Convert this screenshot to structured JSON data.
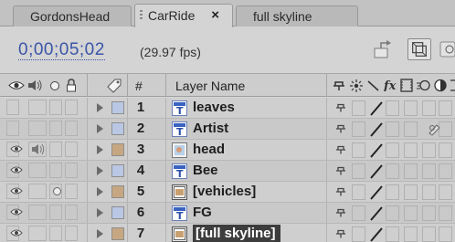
{
  "tabs": [
    {
      "label": "GordonsHead",
      "active": false
    },
    {
      "label": "CarRide",
      "active": true,
      "close": "×"
    },
    {
      "label": "full skyline",
      "active": false
    }
  ],
  "header": {
    "timecode": "0;00;05;02",
    "fps": "(29.97 fps)"
  },
  "columns": {
    "number": "#",
    "layer_name": "Layer Name"
  },
  "layers": [
    {
      "num": "1",
      "name": "leaves",
      "type": "text",
      "label_color": "#b9c7e4",
      "visible": false,
      "audio": false,
      "solo": false,
      "effect": false
    },
    {
      "num": "2",
      "name": "Artist",
      "type": "text",
      "label_color": "#b9c7e4",
      "visible": false,
      "audio": false,
      "solo": false,
      "effect": true
    },
    {
      "num": "3",
      "name": "head",
      "type": "image",
      "label_color": "#c6a782",
      "visible": true,
      "audio": true,
      "solo": false,
      "effect": false
    },
    {
      "num": "4",
      "name": "Bee",
      "type": "text",
      "label_color": "#b9c7e4",
      "visible": true,
      "audio": false,
      "solo": false,
      "effect": false
    },
    {
      "num": "5",
      "name": "[vehicles]",
      "type": "comp",
      "label_color": "#c6a782",
      "visible": true,
      "audio": false,
      "solo": true,
      "effect": false
    },
    {
      "num": "6",
      "name": "FG",
      "type": "text",
      "label_color": "#b9c7e4",
      "visible": true,
      "audio": false,
      "solo": false,
      "effect": false
    },
    {
      "num": "7",
      "name": "[full skyline]",
      "type": "comp",
      "label_color": "#c6a782",
      "visible": true,
      "audio": false,
      "solo": false,
      "effect": false,
      "selected": true
    }
  ],
  "colors": {
    "accent_timecode": "#3a55a8",
    "selection": "#3d3d3d",
    "panel_bg": "#d4d4d4"
  },
  "icons": {
    "header": [
      "flowchart-icon",
      "draft-3d-icon",
      "motion-blur-icon"
    ],
    "column_switches": [
      "shy-icon",
      "collapse-icon",
      "quality-icon",
      "effect-icon",
      "frame-blend-icon",
      "motion-blur-icon",
      "adjustment-icon"
    ]
  }
}
